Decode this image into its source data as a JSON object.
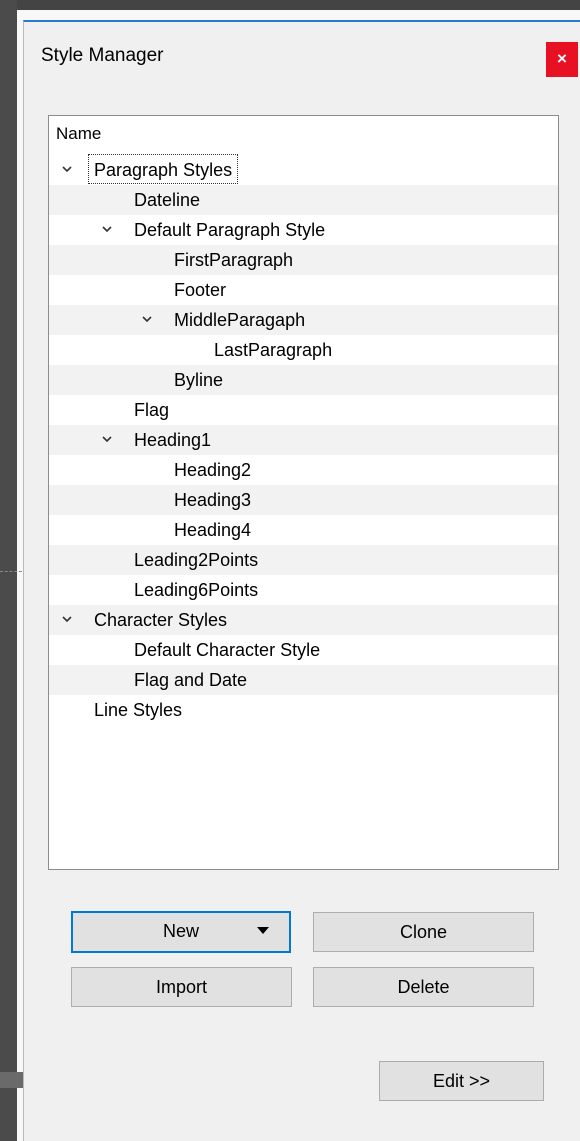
{
  "window": {
    "title": "Style Manager",
    "close_label": "×"
  },
  "tree": {
    "header": "Name",
    "rows": [
      {
        "label": "Paragraph Styles",
        "depth": 0,
        "expanded": true,
        "focused": true
      },
      {
        "label": "Dateline",
        "depth": 1,
        "expanded": null
      },
      {
        "label": "Default Paragraph Style",
        "depth": 1,
        "expanded": true
      },
      {
        "label": "FirstParagraph",
        "depth": 2,
        "expanded": null
      },
      {
        "label": "Footer",
        "depth": 2,
        "expanded": null
      },
      {
        "label": "MiddleParagaph",
        "depth": 2,
        "expanded": true
      },
      {
        "label": "LastParagraph",
        "depth": 3,
        "expanded": null
      },
      {
        "label": "Byline",
        "depth": 2,
        "expanded": null
      },
      {
        "label": "Flag",
        "depth": 1,
        "expanded": null
      },
      {
        "label": "Heading1",
        "depth": 1,
        "expanded": true
      },
      {
        "label": "Heading2",
        "depth": 2,
        "expanded": null
      },
      {
        "label": "Heading3",
        "depth": 2,
        "expanded": null
      },
      {
        "label": "Heading4",
        "depth": 2,
        "expanded": null
      },
      {
        "label": "Leading2Points",
        "depth": 1,
        "expanded": null
      },
      {
        "label": "Leading6Points",
        "depth": 1,
        "expanded": null
      },
      {
        "label": "Character Styles",
        "depth": 0,
        "expanded": true
      },
      {
        "label": "Default Character Style",
        "depth": 1,
        "expanded": null
      },
      {
        "label": "Flag and Date",
        "depth": 1,
        "expanded": null
      },
      {
        "label": "Line Styles",
        "depth": 0,
        "expanded": null
      }
    ]
  },
  "buttons": {
    "new": "New",
    "clone": "Clone",
    "import": "Import",
    "delete": "Delete",
    "edit": "Edit >>"
  },
  "colors": {
    "accent": "#0078d7",
    "close": "#e81123",
    "title_border": "#2b78d0"
  }
}
